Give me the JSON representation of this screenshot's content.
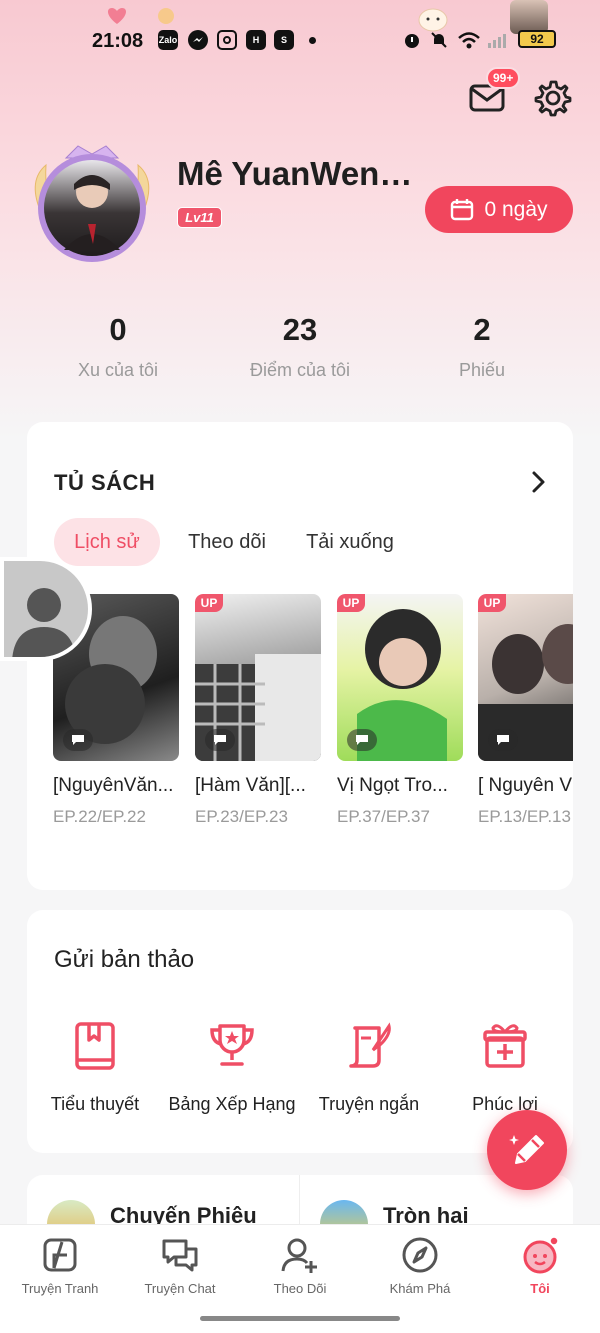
{
  "status_bar": {
    "time": "21:08",
    "battery": "92",
    "app_icons": [
      "Zalo",
      "messenger-icon",
      "instagram-icon",
      "H",
      "shopee-icon"
    ]
  },
  "header": {
    "mail_badge": "99+"
  },
  "profile": {
    "name": "Mê YuanWenH...",
    "level": "Lv11",
    "checkin_label": "0 ngày"
  },
  "stats": [
    {
      "value": "0",
      "label": "Xu của tôi"
    },
    {
      "value": "23",
      "label": "Điểm của tôi"
    },
    {
      "value": "2",
      "label": "Phiếu"
    }
  ],
  "library": {
    "title": "TỦ SÁCH",
    "tabs": [
      {
        "label": "Lịch sử",
        "active": true
      },
      {
        "label": "Theo dõi",
        "active": false
      },
      {
        "label": "Tải xuống",
        "active": false
      }
    ],
    "books": [
      {
        "title": "[NguyênVăn...",
        "episodes": "EP.22/EP.22",
        "up": "",
        "colors": [
          "#2a2a2a",
          "#7a7a7a"
        ]
      },
      {
        "title": "[Hàm Văn][...",
        "episodes": "EP.23/EP.23",
        "up": "UP",
        "colors": [
          "#d9d9d9",
          "#4a4a4a"
        ]
      },
      {
        "title": "Vị Ngọt Tro...",
        "episodes": "EP.37/EP.37",
        "up": "UP",
        "colors": [
          "#d8f07a",
          "#3fb83a"
        ]
      },
      {
        "title": "[ Nguyên V",
        "episodes": "EP.13/EP.13",
        "up": "UP",
        "colors": [
          "#e9d6cc",
          "#3a3a3a"
        ]
      }
    ]
  },
  "submission": {
    "title": "Gửi bản thảo",
    "items": [
      {
        "label": "Tiểu thuyết",
        "icon": "book-icon"
      },
      {
        "label": "Bảng Xếp Hạng",
        "icon": "trophy-icon"
      },
      {
        "label": "Truyện ngắn",
        "icon": "scroll-quill-icon"
      },
      {
        "label": "Phúc lợi",
        "icon": "gift-icon"
      }
    ]
  },
  "bottom_card": {
    "left_label": "Chuyến Phiêu",
    "right_label": "Tròn hai"
  },
  "tabbar": [
    {
      "label": "Truyện Tranh",
      "icon": "comic-icon",
      "active": false
    },
    {
      "label": "Truyện Chat",
      "icon": "chat-icon",
      "active": false
    },
    {
      "label": "Theo Dõi",
      "icon": "follow-icon",
      "active": false
    },
    {
      "label": "Khám Phá",
      "icon": "compass-icon",
      "active": false
    },
    {
      "label": "Tôi",
      "icon": "me-icon",
      "active": true
    }
  ],
  "colors": {
    "accent": "#f1465d",
    "accent_soft": "#fde2e6",
    "hero_top": "#f8c9d1"
  }
}
